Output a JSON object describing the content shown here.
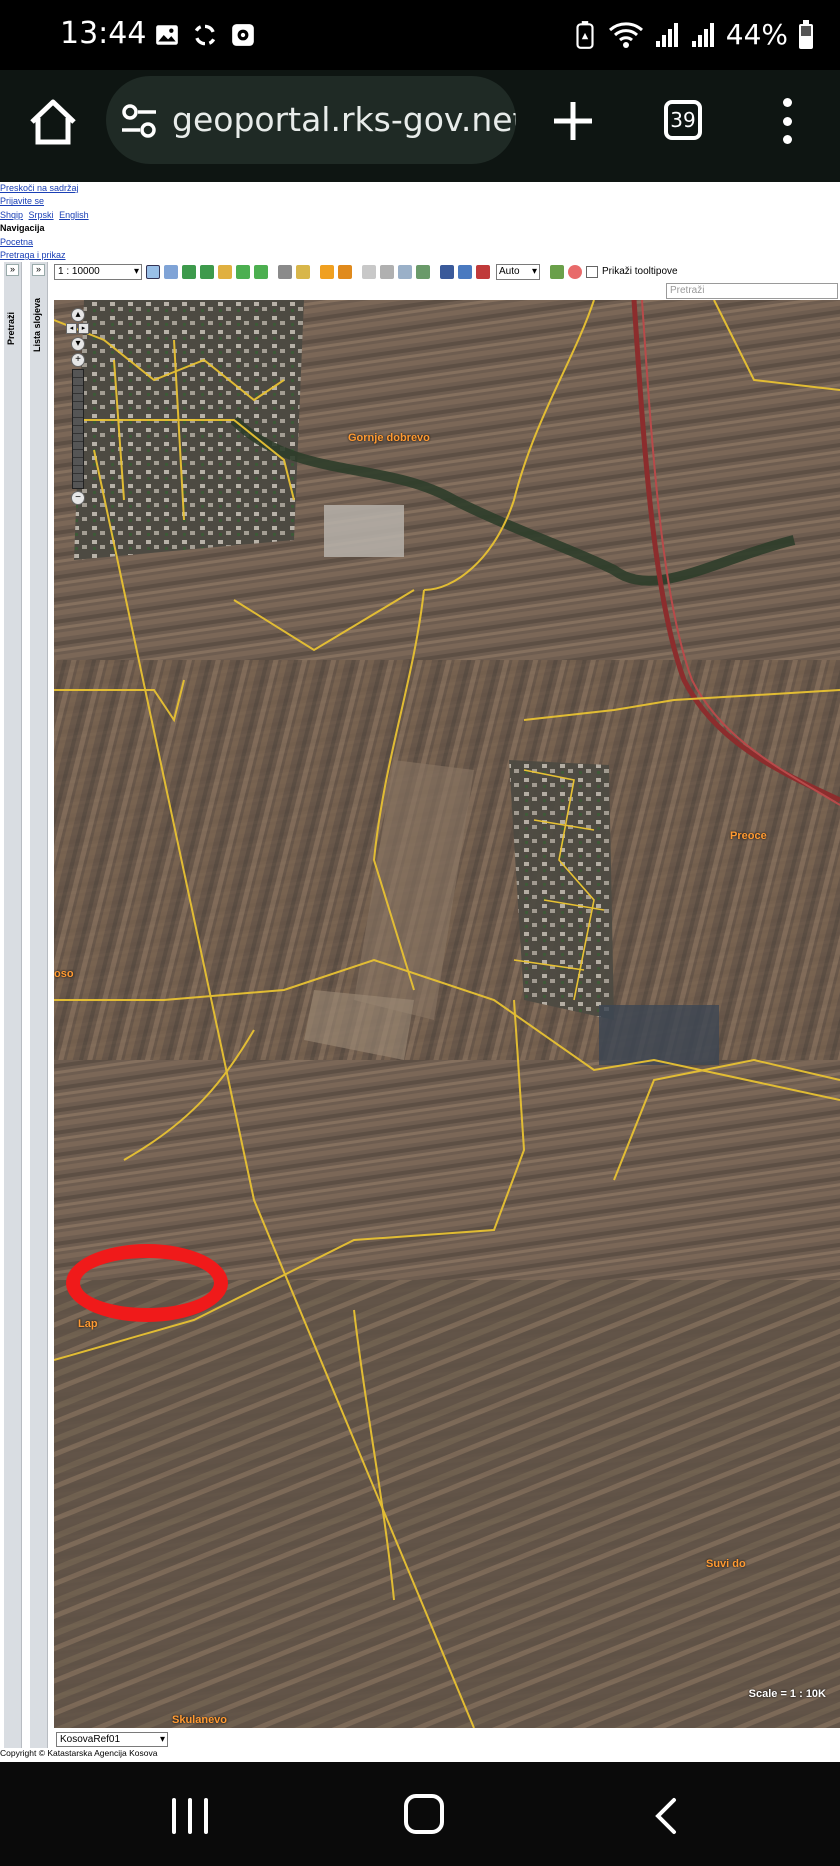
{
  "status": {
    "time": "13:44",
    "battery": "44%",
    "icons": [
      "image-icon",
      "sync-icon",
      "recorder-icon",
      "battery-saver-icon",
      "wifi-icon",
      "signal-icon",
      "signal-icon",
      "battery-icon"
    ]
  },
  "browser": {
    "url": "geoportal.rks-gov.net",
    "tab_count": "39"
  },
  "page": {
    "links": {
      "skip": "Preskoči na sadržaj",
      "login": "Prijavite se",
      "shqip": "Shqip",
      "srpski": "Srpski",
      "english": "English",
      "nav_heading": "Navigacija",
      "home": "Pocetna",
      "search_view": "Pretraga i prikaz"
    },
    "toolbar": {
      "scale": "1 : 10000",
      "auto": "Auto",
      "tooltips_label": "Prikaži tooltipove",
      "search_placeholder": "Pretraži"
    },
    "side_tabs": {
      "search": "Pretraži",
      "layers": "Lista slojeva"
    },
    "map": {
      "labels": {
        "gornje": "Gornje dobrevo",
        "preoce": "Preoce",
        "suvi_do": "Suvi do",
        "skulanevo": "Skulanevo",
        "left_edge": "oso",
        "lap": "Lap"
      },
      "scale_text": "Scale = 1 : 10K"
    },
    "layer": "KosovaRef01",
    "copyright": "Copyright © Katastarska Agencija Kosova"
  },
  "colors": {
    "parcel_lines": "#e8c233",
    "highlight_oval": "#f01a1a",
    "label_orange": "#ff9a32"
  }
}
